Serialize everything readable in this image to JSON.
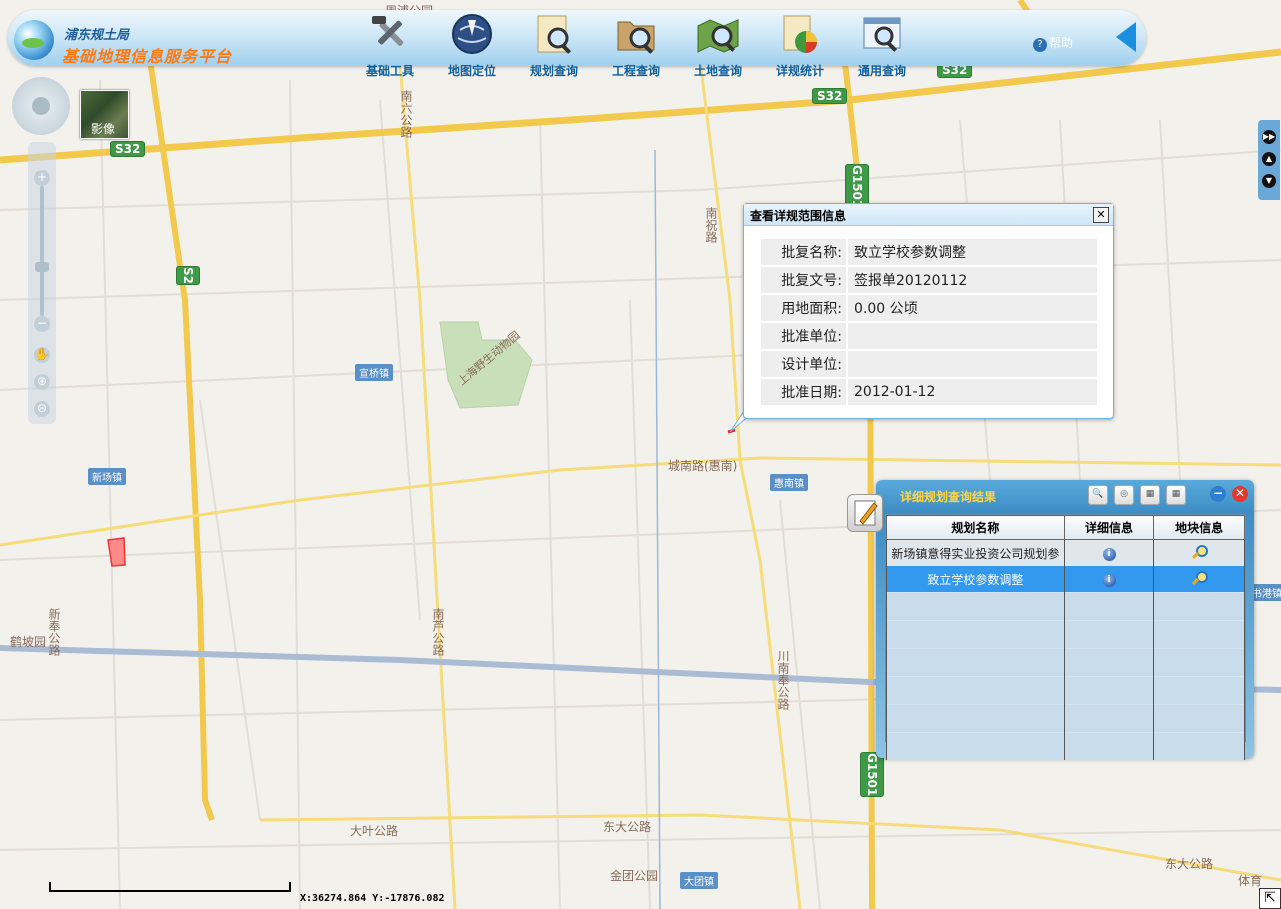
{
  "header": {
    "org_name": "浦东规土局",
    "platform_name": "基础地理信息服务平台",
    "tools": [
      {
        "label": "基础工具",
        "icon": "tools-icon"
      },
      {
        "label": "地图定位",
        "icon": "globe-locate-icon"
      },
      {
        "label": "规划查询",
        "icon": "plan-search-icon"
      },
      {
        "label": "工程查询",
        "icon": "project-search-icon"
      },
      {
        "label": "土地查询",
        "icon": "land-search-icon"
      },
      {
        "label": "详规统计",
        "icon": "pie-chart-icon"
      },
      {
        "label": "通用查询",
        "icon": "general-search-icon"
      }
    ],
    "help_label": "帮助"
  },
  "map": {
    "imagery_label": "影像",
    "road_shields": [
      "S32",
      "S32",
      "S32",
      "S2",
      "G1501",
      "G1501"
    ],
    "road_labels": [
      "南六公路",
      "南祝路",
      "城南路(惠南)",
      "南芦公路",
      "新奉公路",
      "川南奉公路",
      "大叶公路",
      "东大公路",
      "东大公路",
      "上海野生动物园",
      "金团公园",
      "周浦公园"
    ],
    "towns": [
      "宣桥镇",
      "新场镇",
      "惠南镇",
      "鹤坡园",
      "大团镇",
      "书港镇",
      "体育"
    ],
    "coordinates": "X:36274.864  Y:-17876.082"
  },
  "popup": {
    "title": "查看详规范围信息",
    "rows": [
      {
        "key": "批复名称:",
        "value": "致立学校参数调整"
      },
      {
        "key": "批复文号:",
        "value": "签报单20120112"
      },
      {
        "key": "用地面积:",
        "value": "0.00 公顷"
      },
      {
        "key": "批准单位:",
        "value": ""
      },
      {
        "key": "设计单位:",
        "value": ""
      },
      {
        "key": "批准日期:",
        "value": "2012-01-12"
      }
    ]
  },
  "results": {
    "title": "详细规划查询结果",
    "columns": [
      "规划名称",
      "详细信息",
      "地块信息"
    ],
    "rows": [
      {
        "name": "新场镇意得实业投资公司规划参"
      },
      {
        "name": "致立学校参数调整"
      }
    ]
  }
}
